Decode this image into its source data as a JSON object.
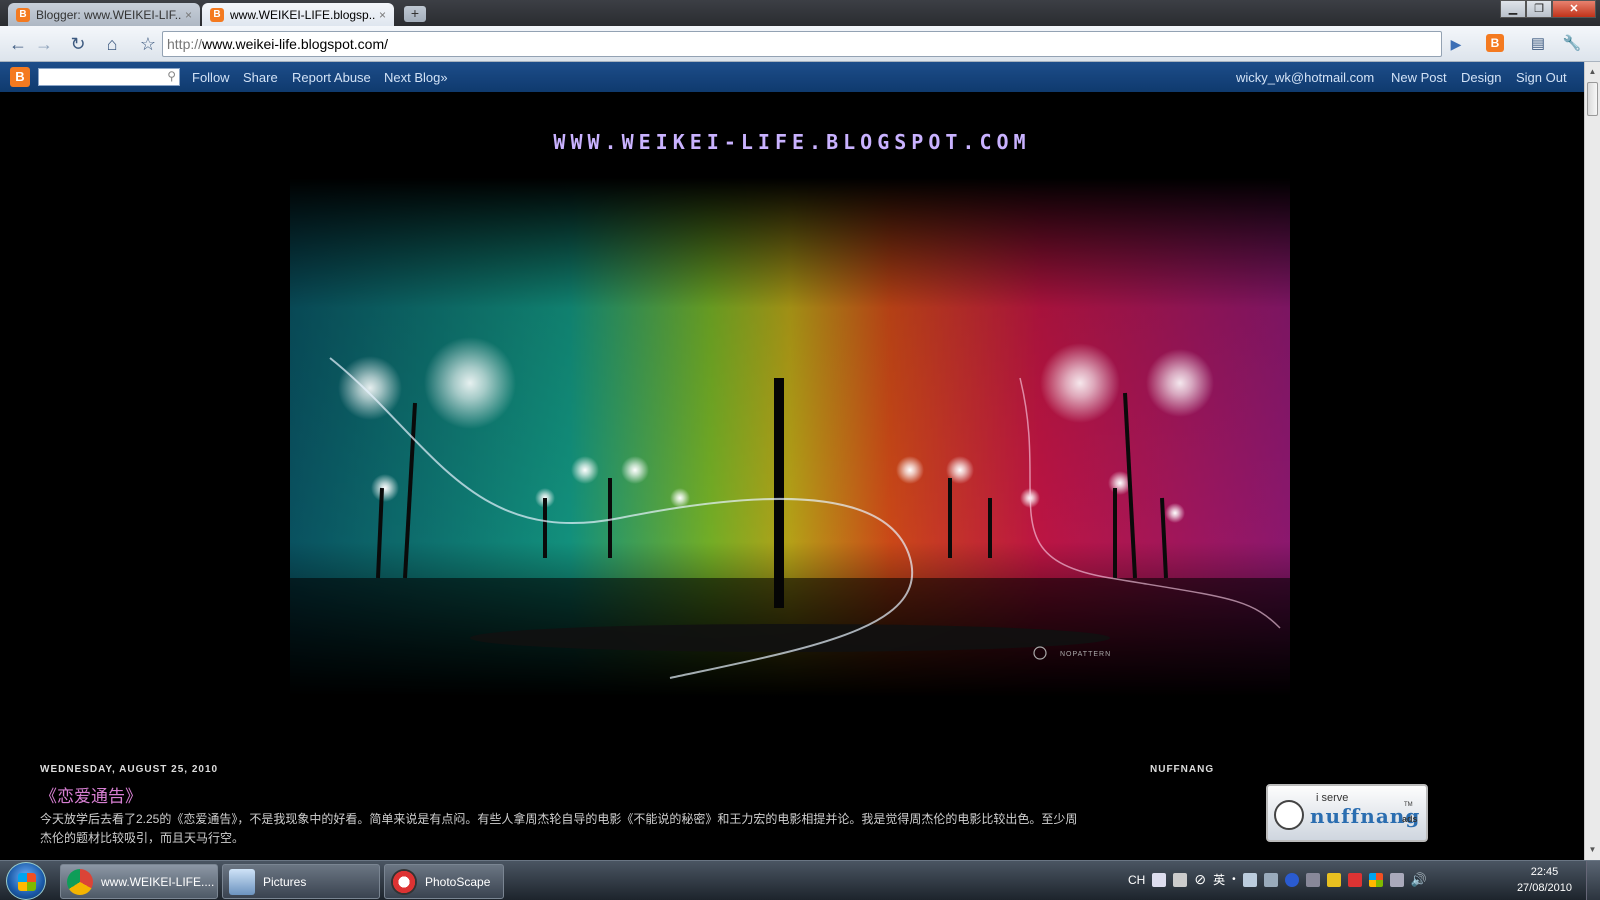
{
  "browser": {
    "tabs": [
      {
        "title": "Blogger: www.WEIKEI-LIF...",
        "active": false
      },
      {
        "title": "www.WEIKEI-LIFE.blogsp...",
        "active": true
      }
    ],
    "url_scheme": "http://",
    "url_rest": "www.weikei-life.blogspot.com/",
    "icons": [
      "back-icon",
      "forward-icon",
      "reload-icon",
      "home-icon",
      "star-icon",
      "go-icon",
      "page-menu-icon",
      "wrench-icon"
    ]
  },
  "navbar": {
    "links": [
      "Follow",
      "Share",
      "Report Abuse",
      "Next Blog»"
    ],
    "user_email": "wicky_wk@hotmail.com",
    "right_links": [
      "New Post",
      "Design",
      "Sign Out"
    ],
    "accent": "#0f3a6e"
  },
  "blog": {
    "site_title": "WWW.WEIKEI-LIFE.BLOGSPOT.COM",
    "header_watermark": "NOPATTERN",
    "post_date": "WEDNESDAY, AUGUST 25, 2010",
    "post_title": "《恋爱通告》",
    "post_body": "今天放学后去看了2.25的《恋爱通告》，不是我现象中的好看。简单来说是有点闷。有些人拿周杰轮自导的电影《不能说的秘密》和王力宏的电影相提并论。我是觉得周杰伦的电影比较出色。至少周杰伦的题材比较吸引，而且天马行空。",
    "sidebar_heading": "NUFFNANG",
    "nuffnang": {
      "serve": "i serve",
      "brand": "nuffnang",
      "ads": "ads",
      "tm": "TM"
    },
    "title_color": "#c9b2ff",
    "post_title_color": "#d77fd2"
  },
  "taskbar": {
    "items": [
      {
        "label": "www.WEIKEI-LIFE....",
        "active": true
      },
      {
        "label": "Pictures",
        "active": false
      },
      {
        "label": "PhotoScape",
        "active": false
      }
    ],
    "tray_lang": "CH",
    "tray_ime": "英",
    "time": "22:45",
    "date": "27/08/2010"
  }
}
